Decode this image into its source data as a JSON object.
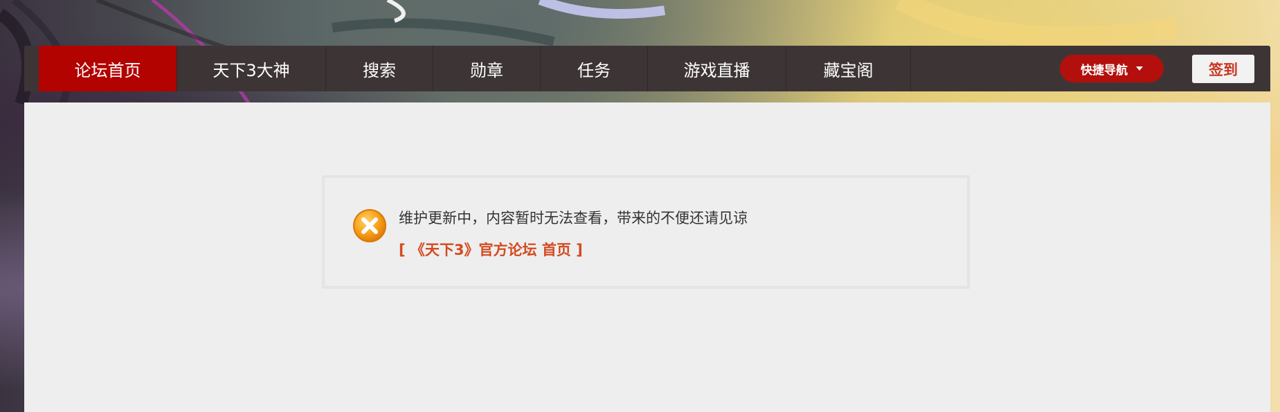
{
  "nav": {
    "items": [
      {
        "label": "论坛首页",
        "active": true
      },
      {
        "label": "天下3大神",
        "active": false
      },
      {
        "label": "搜索",
        "active": false
      },
      {
        "label": "勋章",
        "active": false
      },
      {
        "label": "任务",
        "active": false
      },
      {
        "label": "游戏直播",
        "active": false
      },
      {
        "label": "藏宝阁",
        "active": false
      }
    ],
    "quick_nav_label": "快捷导航",
    "signin_label": "签到"
  },
  "message": {
    "text": "维护更新中，内容暂时无法查看，带来的不便还请见谅",
    "link_label": "[ 《天下3》官方论坛 首页 ]",
    "icon": "error-x-icon"
  },
  "colors": {
    "nav_bg": "#3d3535",
    "nav_active": "#b20300",
    "quick_nav_bg": "#b30f0c",
    "link": "#d4491f",
    "content_bg": "#eeeeee"
  }
}
